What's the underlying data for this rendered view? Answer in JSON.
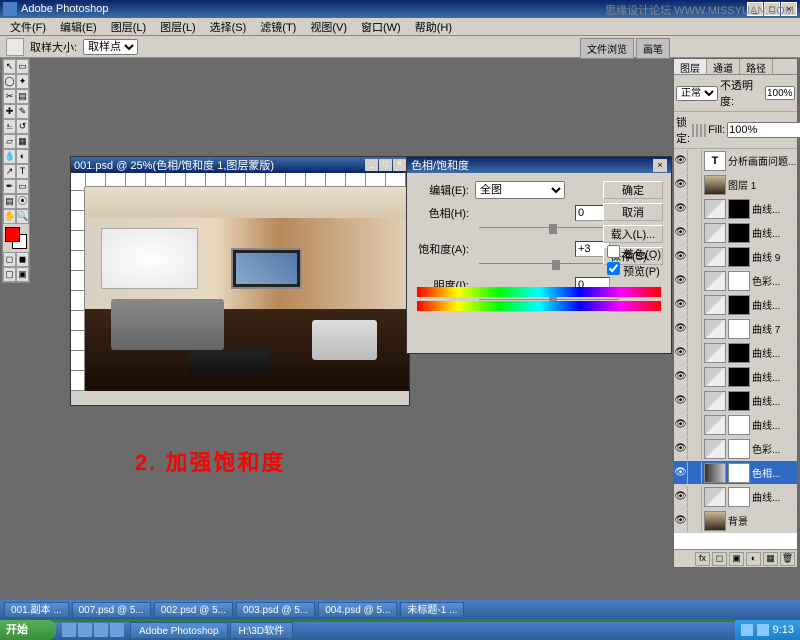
{
  "app": {
    "title": "Adobe Photoshop"
  },
  "watermark": {
    "text": "思缘设计论坛 WWW.MISSYUAN.COM"
  },
  "menu": [
    "文件(F)",
    "编辑(E)",
    "图层(L)",
    "图层(L)",
    "选择(S)",
    "滤镜(T)",
    "视图(V)",
    "窗口(W)",
    "帮助(H)"
  ],
  "options": {
    "label": "取样大小:",
    "value": "取样点",
    "tab1": "文件浏览",
    "tab2": "画笔"
  },
  "document": {
    "title": "001.psd @ 25%(色相/饱和度 1,图层蒙版)"
  },
  "annotation": "2. 加强饱和度",
  "dialog": {
    "title": "色相/饱和度",
    "edit_label": "编辑(E):",
    "edit_value": "全图",
    "hue_label": "色相(H):",
    "hue_value": "0",
    "sat_label": "饱和度(A):",
    "sat_value": "+3",
    "light_label": "明度(I):",
    "light_value": "0",
    "ok": "确定",
    "cancel": "取消",
    "load": "载入(L)...",
    "save": "保存(S)...",
    "colorize": "着色(O)",
    "preview": "预览(P)"
  },
  "layers": {
    "tabs": [
      "图层",
      "通道",
      "路径"
    ],
    "blend": "正常",
    "opacity_label": "不透明度:",
    "opacity": "100%",
    "lock_label": "锁定:",
    "fill_label": "Fill:",
    "fill": "100%",
    "items": [
      {
        "type": "text",
        "name": "分析画面问题...",
        "mask": ""
      },
      {
        "type": "img",
        "name": "图层 1",
        "mask": ""
      },
      {
        "type": "curve",
        "name": "曲线...",
        "mask": "black"
      },
      {
        "type": "curve",
        "name": "曲线...",
        "mask": "black"
      },
      {
        "type": "curve",
        "name": "曲线 9",
        "mask": "black"
      },
      {
        "type": "curve",
        "name": "色彩...",
        "mask": "white"
      },
      {
        "type": "curve",
        "name": "曲线...",
        "mask": "black"
      },
      {
        "type": "curve",
        "name": "曲线 7",
        "mask": "white"
      },
      {
        "type": "curve",
        "name": "曲线...",
        "mask": "black"
      },
      {
        "type": "curve",
        "name": "曲线...",
        "mask": "black"
      },
      {
        "type": "curve",
        "name": "曲线...",
        "mask": "black"
      },
      {
        "type": "curve",
        "name": "曲线...",
        "mask": "white"
      },
      {
        "type": "curve",
        "name": "色彩...",
        "mask": "white"
      },
      {
        "type": "grad",
        "name": "色相...",
        "mask": "white",
        "sel": true
      },
      {
        "type": "curve",
        "name": "曲线...",
        "mask": "white"
      },
      {
        "type": "img",
        "name": "背景",
        "mask": ""
      }
    ]
  },
  "appbar": [
    "001.副本 ...",
    "007.psd @ 5...",
    "002.psd @ 5...",
    "003.psd @ 5...",
    "004.psd @ 5...",
    "未标题-1 ..."
  ],
  "taskbar": {
    "start": "开始",
    "apps": [
      "Adobe Photoshop",
      "H:\\3D软件"
    ],
    "time": "9:13"
  }
}
